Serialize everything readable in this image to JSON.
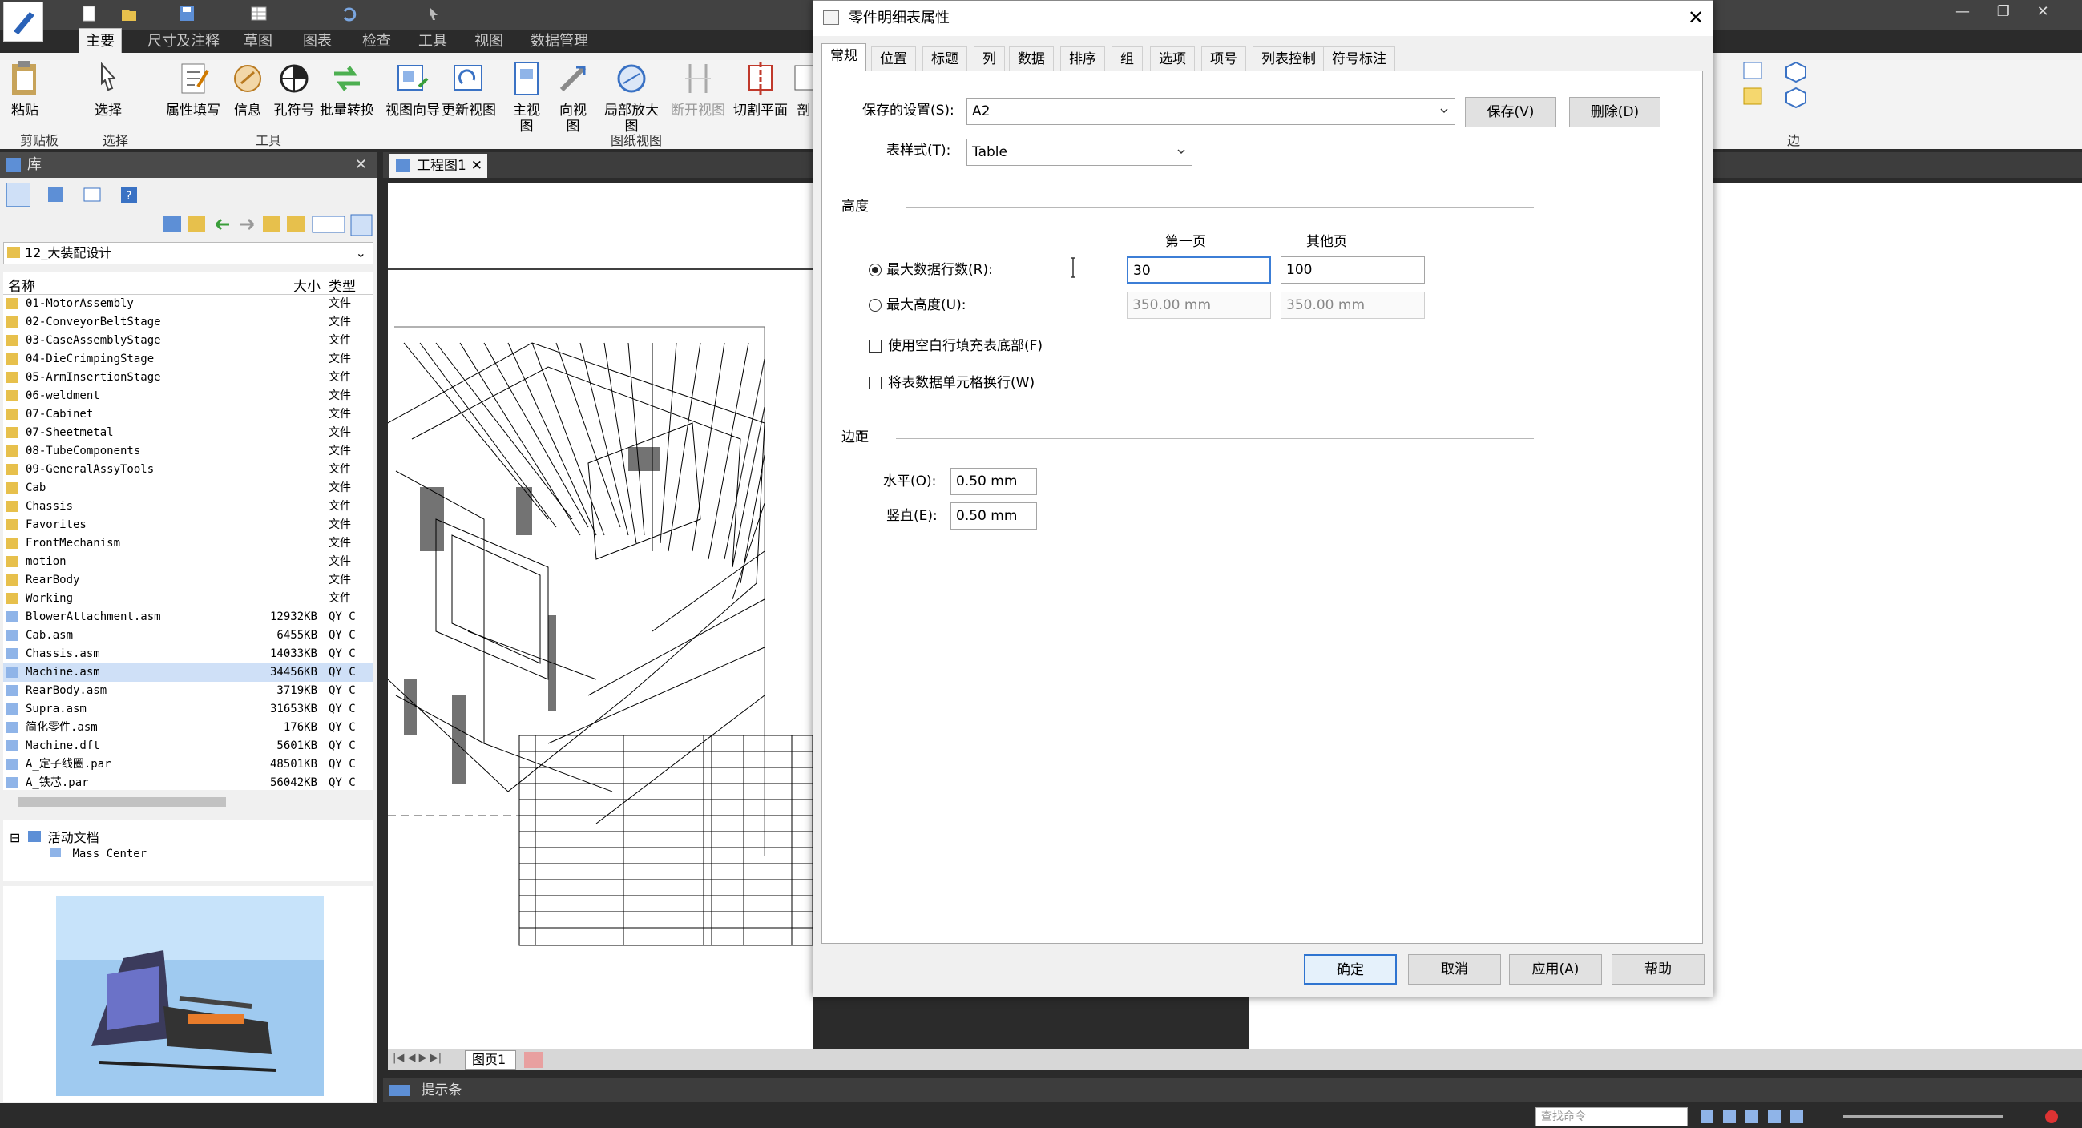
{
  "ribbon": {
    "tabs": [
      "主要",
      "尺寸及注释",
      "草图",
      "图表",
      "检查",
      "工具",
      "视图",
      "数据管理"
    ],
    "buttons": [
      "粘贴",
      "选择",
      "属性填写",
      "信息",
      "孔符号",
      "批量转换",
      "视图向导",
      "更新视图",
      "主视图",
      "向视图",
      "局部放大图",
      "断开视图",
      "切割平面",
      "剖"
    ],
    "groups": [
      "剪贴板",
      "选择",
      "工具",
      "图纸视图",
      "边"
    ]
  },
  "library": {
    "title": "库",
    "folder": "12_大装配设计",
    "columns": {
      "name": "名称",
      "size": "大小",
      "type": "类型"
    },
    "files": [
      {
        "name": "01-MotorAssembly",
        "size": "",
        "type": "文件"
      },
      {
        "name": "02-ConveyorBeltStage",
        "size": "",
        "type": "文件"
      },
      {
        "name": "03-CaseAssemblyStage",
        "size": "",
        "type": "文件"
      },
      {
        "name": "04-DieCrimpingStage",
        "size": "",
        "type": "文件"
      },
      {
        "name": "05-ArmInsertionStage",
        "size": "",
        "type": "文件"
      },
      {
        "name": "06-weldment",
        "size": "",
        "type": "文件"
      },
      {
        "name": "07-Cabinet",
        "size": "",
        "type": "文件"
      },
      {
        "name": "07-Sheetmetal",
        "size": "",
        "type": "文件"
      },
      {
        "name": "08-TubeComponents",
        "size": "",
        "type": "文件"
      },
      {
        "name": "09-GeneralAssyTools",
        "size": "",
        "type": "文件"
      },
      {
        "name": "Cab",
        "size": "",
        "type": "文件"
      },
      {
        "name": "Chassis",
        "size": "",
        "type": "文件"
      },
      {
        "name": "Favorites",
        "size": "",
        "type": "文件"
      },
      {
        "name": "FrontMechanism",
        "size": "",
        "type": "文件"
      },
      {
        "name": "motion",
        "size": "",
        "type": "文件"
      },
      {
        "name": "RearBody",
        "size": "",
        "type": "文件"
      },
      {
        "name": "Working",
        "size": "",
        "type": "文件"
      },
      {
        "name": "BlowerAttachment.asm",
        "size": "12932KB",
        "type": "QY C"
      },
      {
        "name": "Cab.asm",
        "size": "6455KB",
        "type": "QY C"
      },
      {
        "name": "Chassis.asm",
        "size": "14033KB",
        "type": "QY C"
      },
      {
        "name": "Machine.asm",
        "size": "34456KB",
        "type": "QY C"
      },
      {
        "name": "RearBody.asm",
        "size": "3719KB",
        "type": "QY C"
      },
      {
        "name": "Supra.asm",
        "size": "31653KB",
        "type": "QY C"
      },
      {
        "name": "简化零件.asm",
        "size": "176KB",
        "type": "QY C"
      },
      {
        "name": "Machine.dft",
        "size": "5601KB",
        "type": "QY C"
      },
      {
        "name": "A_定子线圈.par",
        "size": "48501KB",
        "type": "QY C"
      },
      {
        "name": "A_铁芯.par",
        "size": "56042KB",
        "type": "QY C"
      }
    ],
    "tree": {
      "root": "活动文档",
      "child": "Mass Center"
    }
  },
  "document": {
    "tab": "工程图1",
    "sheet_tab": "图页1",
    "status_label": "提示条",
    "search_placeholder": "查找命令"
  },
  "dialog": {
    "title": "零件明细表属性",
    "tabs": [
      "常规",
      "位置",
      "标题",
      "列",
      "数据",
      "排序",
      "组",
      "选项",
      "项号",
      "列表控制",
      "符号标注"
    ],
    "saved_settings_label": "保存的设置(S):",
    "saved_settings_value": "A2",
    "save_btn": "保存(V)",
    "delete_btn": "删除(D)",
    "table_style_label": "表样式(T):",
    "table_style_value": "Table",
    "height_section": "高度",
    "first_page": "第一页",
    "other_pages": "其他页",
    "max_rows_label": "最大数据行数(R):",
    "max_rows_first": "30",
    "max_rows_other": "100",
    "max_height_label": "最大高度(U):",
    "max_height_first": "350.00 mm",
    "max_height_other": "350.00 mm",
    "fill_blank_label": "使用空白行填充表底部(F)",
    "wrap_label": "将表数据单元格换行(W)",
    "margin_section": "边距",
    "horizontal_label": "水平(O):",
    "horizontal_value": "0.50 mm",
    "vertical_label": "竖直(E):",
    "vertical_value": "0.50 mm",
    "ok_btn": "确定",
    "cancel_btn": "取消",
    "apply_btn": "应用(A)",
    "help_btn": "帮助"
  }
}
